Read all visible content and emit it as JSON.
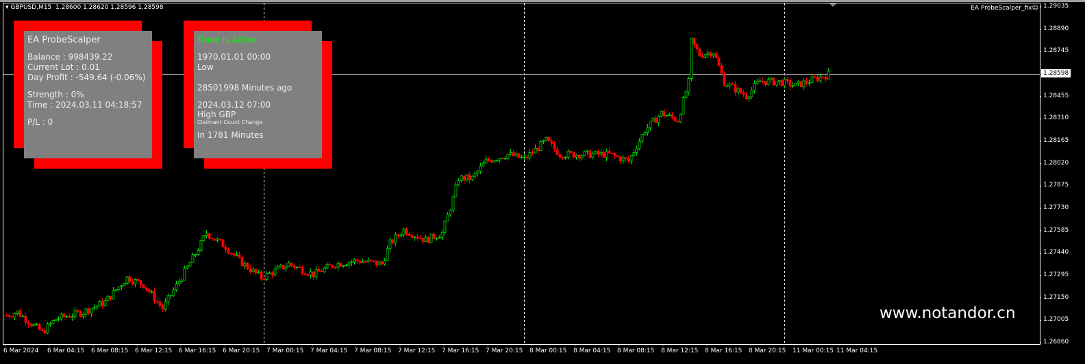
{
  "header": {
    "symbol": "GBPUSD,M15",
    "ohlc": "1.28600 1.28620 1.28596 1.28598",
    "ea_name": "EA ProbeScalper_fix",
    "ea_icon": "smiley-icon"
  },
  "panel_left": {
    "title": "EA ProbeScalper",
    "balance": "Balance : 998439.22",
    "lot": "Current Lot : 0.01",
    "day_profit": "Day Profit : -549.64 (-0.06%)",
    "strength": "Strength : 0%",
    "time": "Time : 2024.03.11 04:18:57",
    "pl": "P/L : 0"
  },
  "panel_right": {
    "status": "Trade is Active",
    "last_time": "1970.01.01 00:00",
    "last_impact": "Low",
    "ago": "28501998 Minutes ago",
    "next_time": "2024.03.12 07:00",
    "next_impact": "High GBP",
    "next_event": "Claimant Count Change",
    "in": "In 1781 Minutes"
  },
  "watermark": "www.notandor.cn",
  "colors": {
    "up": "#00e000",
    "down": "#ff0000",
    "status": "#00ff00",
    "panel": "#808080",
    "panel_border": "#ff0000"
  },
  "chart_data": {
    "type": "candlestick",
    "bid": "1.28598",
    "ylim": [
      1.2686,
      1.29035
    ],
    "price_ticks": [
      "1.29035",
      "1.28890",
      "1.28745",
      "1.28598",
      "1.28455",
      "1.28310",
      "1.28165",
      "1.28020",
      "1.27875",
      "1.27730",
      "1.27585",
      "1.27440",
      "1.27295",
      "1.27150",
      "1.27005",
      "1.26860"
    ],
    "time_ticks": [
      "6 Mar 2024",
      "6 Mar 04:15",
      "6 Mar 08:15",
      "6 Mar 12:15",
      "6 Mar 16:15",
      "6 Mar 20:15",
      "7 Mar 00:15",
      "7 Mar 04:15",
      "7 Mar 08:15",
      "7 Mar 12:15",
      "7 Mar 16:15",
      "7 Mar 20:15",
      "8 Mar 00:15",
      "8 Mar 04:15",
      "8 Mar 08:15",
      "8 Mar 12:15",
      "8 Mar 16:15",
      "8 Mar 20:15",
      "11 Mar 00:15",
      "11 Mar 04:15"
    ],
    "bars_per_tick": 16,
    "day_separators": [
      94,
      189,
      284
    ],
    "close_anchors": [
      [
        0,
        1.27037
      ],
      [
        4,
        1.27059
      ],
      [
        13,
        1.26926
      ],
      [
        18,
        1.27015
      ],
      [
        28,
        1.27059
      ],
      [
        36,
        1.27126
      ],
      [
        44,
        1.27281
      ],
      [
        50,
        1.27237
      ],
      [
        57,
        1.27081
      ],
      [
        63,
        1.27259
      ],
      [
        69,
        1.27437
      ],
      [
        73,
        1.2757
      ],
      [
        80,
        1.27481
      ],
      [
        85,
        1.27392
      ],
      [
        93,
        1.27281
      ],
      [
        103,
        1.2737
      ],
      [
        112,
        1.27303
      ],
      [
        120,
        1.2737
      ],
      [
        128,
        1.27392
      ],
      [
        137,
        1.2737
      ],
      [
        140,
        1.27503
      ],
      [
        145,
        1.27592
      ],
      [
        153,
        1.27525
      ],
      [
        159,
        1.2757
      ],
      [
        163,
        1.27792
      ],
      [
        165,
        1.27925
      ],
      [
        170,
        1.27925
      ],
      [
        175,
        1.28036
      ],
      [
        183,
        1.2808
      ],
      [
        189,
        1.28049
      ],
      [
        197,
        1.28169
      ],
      [
        202,
        1.2808
      ],
      [
        210,
        1.2808
      ],
      [
        220,
        1.2808
      ],
      [
        227,
        1.28036
      ],
      [
        233,
        1.28236
      ],
      [
        239,
        1.28347
      ],
      [
        245,
        1.28302
      ],
      [
        249,
        1.28547
      ],
      [
        250,
        1.28813
      ],
      [
        253,
        1.28724
      ],
      [
        258,
        1.28746
      ],
      [
        262,
        1.28547
      ],
      [
        270,
        1.28458
      ],
      [
        275,
        1.28555
      ],
      [
        283,
        1.28547
      ],
      [
        288,
        1.28524
      ],
      [
        293,
        1.28555
      ],
      [
        300,
        1.28598
      ]
    ]
  }
}
